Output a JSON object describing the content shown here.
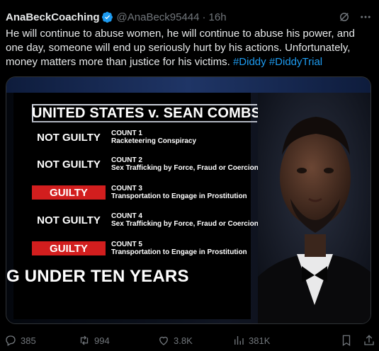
{
  "tweet": {
    "display_name": "AnaBeckCoaching",
    "handle": "@AnaBeck95444",
    "separator": "·",
    "time": "16h",
    "text_main": "He will continue to abuse women, he will continue to abuse his power, and one day, someone will end up seriously hurt by his actions. Unfortunately, money matters more than justice for his victims.",
    "hashtags": [
      "#Diddy",
      "#DiddyTrial"
    ]
  },
  "graphic": {
    "title": "UNITED STATES v. SEAN COMBS",
    "counts": [
      {
        "verdict": "NOT GUILTY",
        "guilty": false,
        "count": "COUNT 1",
        "charge": "Racketeering Conspiracy"
      },
      {
        "verdict": "NOT GUILTY",
        "guilty": false,
        "count": "COUNT 2",
        "charge": "Sex Trafficking by Force, Fraud or Coercion"
      },
      {
        "verdict": "GUILTY",
        "guilty": true,
        "count": "COUNT 3",
        "charge": "Transportation to Engage in Prostitution"
      },
      {
        "verdict": "NOT GUILTY",
        "guilty": false,
        "count": "COUNT 4",
        "charge": "Sex Trafficking by Force, Fraud or Coercion"
      },
      {
        "verdict": "GUILTY",
        "guilty": true,
        "count": "COUNT 5",
        "charge": "Transportation to Engage in Prostitution"
      }
    ],
    "banner": "G UNDER TEN YEARS"
  },
  "actions": {
    "replies": "385",
    "reposts": "994",
    "likes": "3.8K",
    "views": "381K"
  },
  "colors": {
    "accent": "#1d9bf0",
    "muted": "#71767b",
    "guilty_red": "#d21e1e"
  },
  "icons": [
    "verified-badge-icon",
    "grok-icon",
    "more-icon",
    "reply-icon",
    "repost-icon",
    "like-icon",
    "views-icon",
    "bookmark-icon",
    "share-icon"
  ]
}
